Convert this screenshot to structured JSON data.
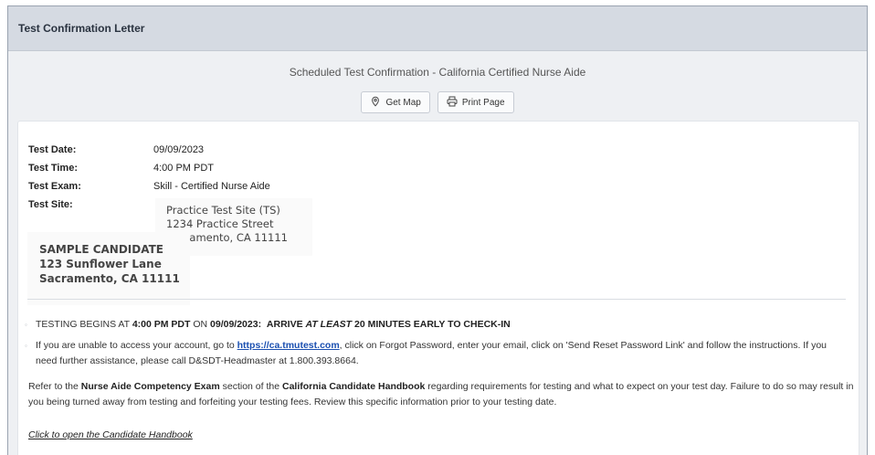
{
  "header": {
    "title": "Test Confirmation Letter"
  },
  "subtitle": "Scheduled Test Confirmation - California Certified Nurse Aide",
  "actions": {
    "get_map": "Get Map",
    "print_page": "Print Page"
  },
  "details": {
    "date_label": "Test Date:",
    "date_value": "09/09/2023",
    "time_label": "Test Time:",
    "time_value": "4:00 PM PDT",
    "exam_label": "Test Exam:",
    "exam_value": "Skill - Certified Nurse Aide",
    "site_label": "Test Site:"
  },
  "site": {
    "name": "Practice Test Site (TS)",
    "street": "1234 Practice Street",
    "city": "Sacramento, CA 11111"
  },
  "candidate": {
    "name": "SAMPLE CANDIDATE",
    "street": "123 Sunflower Lane",
    "city": "Sacramento, CA 11111"
  },
  "bullet1": {
    "a": "TESTING BEGINS AT ",
    "b": "4:00 PM PDT",
    "c": " ON ",
    "d": "09/09/2023:",
    "e": "ARRIVE ",
    "f": "AT LEAST",
    "g": " 20 MINUTES EARLY TO CHECK-IN"
  },
  "bullet2": {
    "a": "If you are unable to access your account, go to ",
    "link": "https://ca.tmutest.com",
    "b": ", click on Forgot Password, enter your email, click on 'Send Reset Password Link' and follow the instructions.  If you need further assistance, please call D&SDT-Headmaster at 1.800.393.8664."
  },
  "paragraph": {
    "a": "Refer to the ",
    "b": "Nurse Aide Competency Exam",
    "c": " section of the ",
    "d": "California Candidate Handbook",
    "e": " regarding requirements for testing and what to expect on your test day.  Failure to do so may result in you being turned away from testing and forfeiting your testing fees.  Review this specific information prior to your testing date."
  },
  "handbook_link": "Click to open the Candidate Handbook",
  "icons": {
    "map": "map-pin-icon",
    "print": "printer-icon"
  }
}
